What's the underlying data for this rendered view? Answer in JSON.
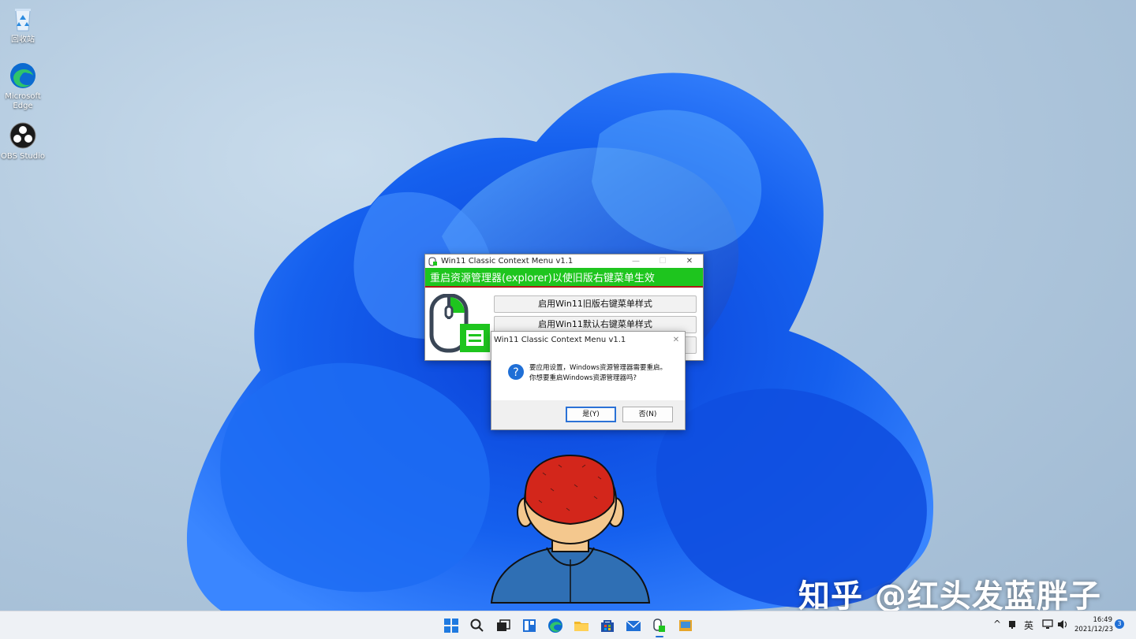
{
  "desktop": {
    "icons": [
      {
        "label": "回收站"
      },
      {
        "label": "Microsoft Edge"
      },
      {
        "label": "OBS Studio"
      }
    ]
  },
  "app_window": {
    "title": "Win11 Classic Context Menu v1.1",
    "minimize": "—",
    "maximize": "☐",
    "close": "✕",
    "banner": "重启资源管理器(explorer)以使旧版右键菜单生效",
    "button_enable_old": "启用Win11旧版右键菜单样式",
    "button_enable_default": "启用Win11默认右键菜单样式"
  },
  "dialog": {
    "title": "Win11 Classic Context Menu v1.1",
    "close": "✕",
    "message_line1": "要应用设置，Windows资源管理器需要重启。",
    "message_line2": "你想要重启Windows资源管理器吗?",
    "yes_label": "是(Y)",
    "no_label": "否(N)"
  },
  "watermark": "知乎 @红头发蓝胖子",
  "taskbar": {
    "tray_chevron": "^",
    "ime": "英",
    "time": "16:49",
    "date": "2021/12/23",
    "notification_count": "3"
  },
  "colors": {
    "accent_green": "#1ec51e",
    "banner_underline": "#b01818",
    "windows_blue": "#1f6fd6"
  }
}
